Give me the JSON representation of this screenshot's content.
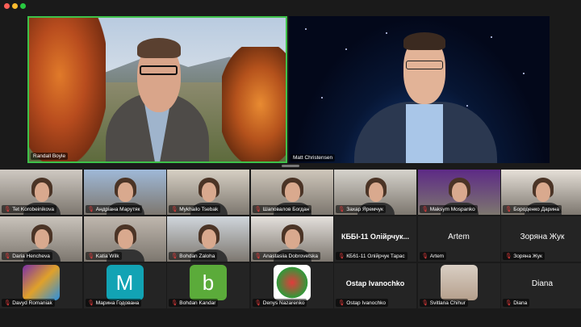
{
  "window": {
    "controls": [
      "close",
      "minimize",
      "zoom"
    ]
  },
  "speakers": [
    {
      "name": "Randall Boyle",
      "active": true
    },
    {
      "name": "Matt Christensen",
      "active": false
    }
  ],
  "gallery": [
    {
      "name": "Tet Korobeinikova",
      "kind": "video"
    },
    {
      "name": "Андріана Марутяк",
      "kind": "video"
    },
    {
      "name": "Mykhailo Tsebak",
      "kind": "video"
    },
    {
      "name": "Шаповалов Богдан",
      "kind": "video"
    },
    {
      "name": "Захар Яремчук",
      "kind": "video"
    },
    {
      "name": "Maksym Mospanko",
      "kind": "video"
    },
    {
      "name": "Бороденко Дарина",
      "kind": "video"
    },
    {
      "name": "Daria Hencheva",
      "kind": "video"
    },
    {
      "name": "Katia Wilk",
      "kind": "video"
    },
    {
      "name": "Bohdan Zaloha",
      "kind": "video"
    },
    {
      "name": "Anastasiia Dobrovetska",
      "kind": "video"
    },
    {
      "name": "КБ61-11 Олійрчук Тарас",
      "kind": "name",
      "display": "КББІ-11 Олійрчук..."
    },
    {
      "name": "Artem",
      "kind": "name",
      "display": "Artem"
    },
    {
      "name": "Зоряна Жук",
      "kind": "name",
      "display": "Зоряна Жук"
    },
    {
      "name": "Davyd Romaniak",
      "kind": "picture"
    },
    {
      "name": "Марина Годована",
      "kind": "letter",
      "letter": "M",
      "color": "#12a3b4"
    },
    {
      "name": "Bohdan Kandar",
      "kind": "letter",
      "letter": "b",
      "color": "#5bab3a"
    },
    {
      "name": "Denys Nazarenko",
      "kind": "picture"
    },
    {
      "name": "Ostap Ivanochko",
      "kind": "name",
      "display": "Ostap Ivanochko"
    },
    {
      "name": "Svitlana Chihur",
      "kind": "picture"
    },
    {
      "name": "Diana",
      "kind": "name",
      "display": "Diana"
    }
  ],
  "colors": {
    "active_speaker_border": "#3ec14a",
    "muted_mic": "#e03a3a",
    "background": "#1a1a1a"
  }
}
